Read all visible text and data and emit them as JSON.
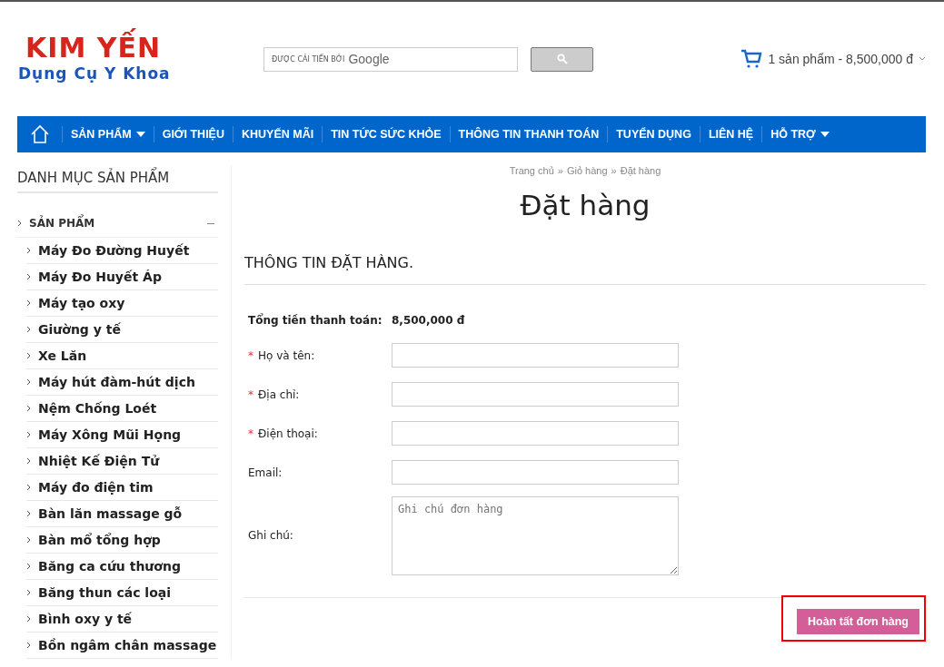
{
  "logo": {
    "name": "KIM YẾN",
    "tagline": "Dụng Cụ Y Khoa"
  },
  "search": {
    "placeholder": "ĐƯỢC CẢI TIẾN BỞI",
    "brand": "Google"
  },
  "cart": {
    "summary": "1 sản phẩm - 8,500,000 đ"
  },
  "nav": [
    {
      "label": "SẢN PHẨM",
      "dropdown": true
    },
    {
      "label": "GIỚI THIỆU",
      "dropdown": false
    },
    {
      "label": "KHUYẾN MÃI",
      "dropdown": false
    },
    {
      "label": "TIN TỨC SỨC KHỎE",
      "dropdown": false
    },
    {
      "label": "THÔNG TIN THANH TOÁN",
      "dropdown": false
    },
    {
      "label": "TUYỂN DỤNG",
      "dropdown": false
    },
    {
      "label": "LIÊN HỆ",
      "dropdown": false
    },
    {
      "label": "HỖ TRỢ",
      "dropdown": true
    }
  ],
  "sidebar": {
    "title": "DANH MỤC SẢN PHẨM",
    "items": [
      {
        "label": "SẢN PHẨM",
        "expanded": true,
        "children": [
          {
            "label": "Máy Đo Đường Huyết"
          },
          {
            "label": "Máy Đo Huyết Áp"
          },
          {
            "label": "Máy tạo oxy"
          },
          {
            "label": "Giường y tế"
          },
          {
            "label": "Xe Lăn"
          },
          {
            "label": "Máy hút đàm-hút dịch"
          },
          {
            "label": "Nệm Chống Loét"
          },
          {
            "label": "Máy Xông Mũi Họng"
          },
          {
            "label": "Nhiệt Kế Điện Tử"
          },
          {
            "label": "Máy đo điện tim"
          },
          {
            "label": "Bàn lăn massage gỗ"
          },
          {
            "label": "Bàn mổ tổng hợp"
          },
          {
            "label": "Băng ca cứu thương"
          },
          {
            "label": "Băng thun các loại"
          },
          {
            "label": "Bình oxy y tế"
          },
          {
            "label": "Bồn ngâm chân massage"
          }
        ]
      }
    ]
  },
  "breadcrumb": [
    "Trang chủ",
    "Giỏ hàng",
    "Đặt hàng"
  ],
  "breadcrumb_separator": "»",
  "page_title": "Đặt hàng",
  "section_title": "THÔNG TIN ĐẶT HÀNG.",
  "total": {
    "label": "Tổng tiền thanh toán:",
    "value": "8,500,000 đ"
  },
  "required_mark": "*",
  "fields": [
    {
      "label": "Họ và tên:",
      "kind": "text",
      "required": true
    },
    {
      "label": "Địa chỉ:",
      "kind": "text",
      "required": true
    },
    {
      "label": "Điện thoại:",
      "kind": "text",
      "required": true
    },
    {
      "label": "Email:",
      "kind": "text",
      "required": false
    },
    {
      "label": "Ghi chú:",
      "kind": "textarea",
      "required": false,
      "placeholder": "Ghi chú đơn hàng"
    }
  ],
  "submit": {
    "label": "Hoàn tất đơn hàng",
    "highlighted": true
  }
}
